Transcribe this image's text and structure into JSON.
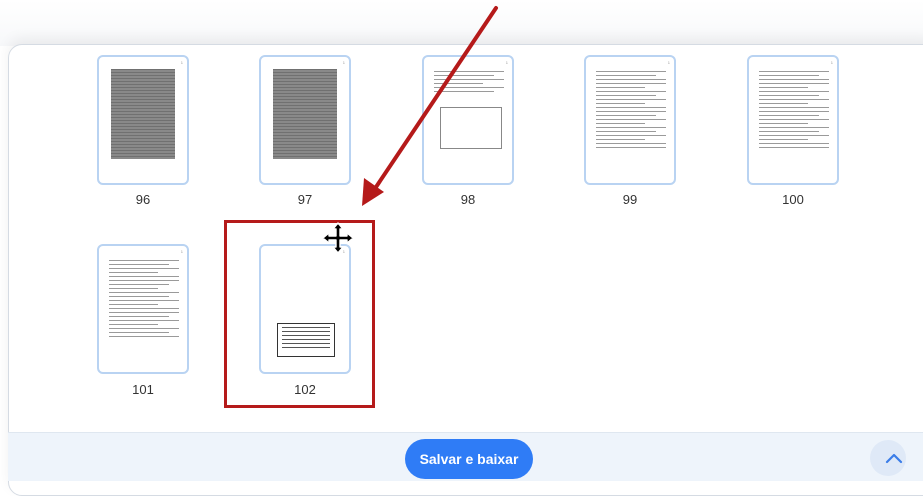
{
  "pages": [
    {
      "number": "96",
      "kind": "scan",
      "page_marker": "1"
    },
    {
      "number": "97",
      "kind": "scan",
      "page_marker": "1"
    },
    {
      "number": "98",
      "kind": "form",
      "page_marker": "1"
    },
    {
      "number": "99",
      "kind": "text",
      "page_marker": "1"
    },
    {
      "number": "100",
      "kind": "text",
      "page_marker": "1"
    },
    {
      "number": "101",
      "kind": "text",
      "page_marker": "1"
    },
    {
      "number": "102",
      "kind": "form-box",
      "page_marker": "1"
    }
  ],
  "actions": {
    "save_download": "Salvar e baixar"
  },
  "icons": {
    "move": "move-icon",
    "scroll_up": "chevron-up-icon"
  },
  "colors": {
    "accent": "#2f7cf6",
    "highlight": "#b51a1a",
    "thumb_border": "#b9d3f2"
  }
}
